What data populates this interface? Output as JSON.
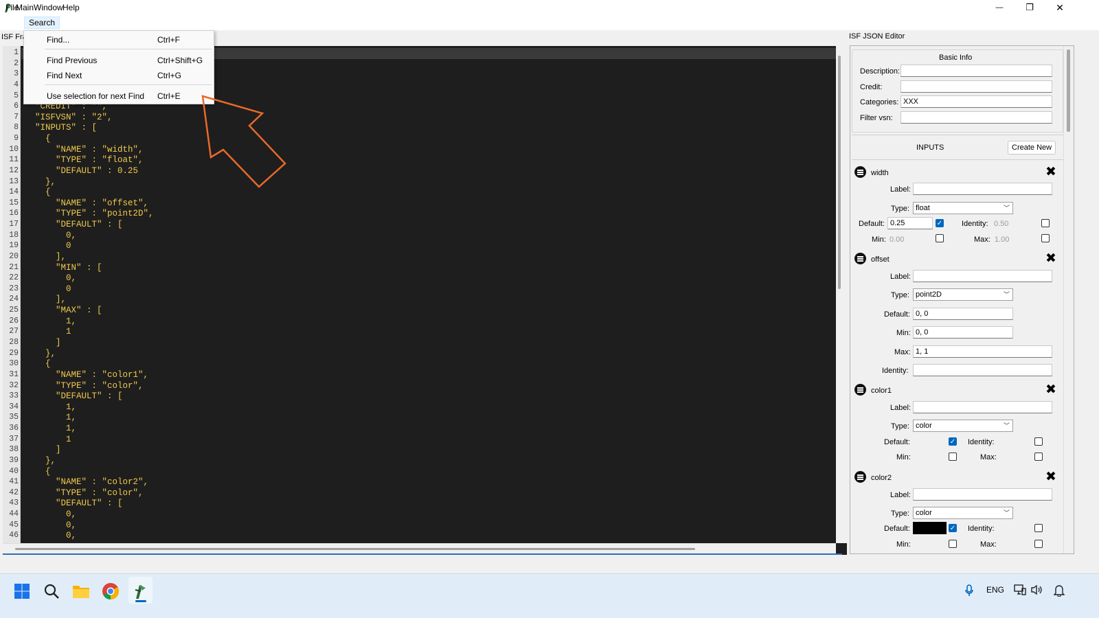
{
  "window": {
    "title": "MainWindow",
    "minimize": "—",
    "maximize": "❐",
    "close": "✕"
  },
  "menubar": {
    "file": "File",
    "search": "Search",
    "help": "Help"
  },
  "left_panel_label": "ISF Fra",
  "search_menu": {
    "items": [
      {
        "label": "Find...",
        "shortcut": "Ctrl+F"
      },
      {
        "label": "Find Previous",
        "shortcut": "Ctrl+Shift+G"
      },
      {
        "label": "Find Next",
        "shortcut": "Ctrl+G"
      },
      {
        "label": "Use selection for next Find",
        "shortcut": "Ctrl+E"
      }
    ]
  },
  "editor": {
    "line_numbers": [
      "1",
      "2",
      "3",
      "4",
      "5",
      "6",
      "7",
      "8",
      "9",
      "10",
      "11",
      "12",
      "13",
      "14",
      "15",
      "16",
      "17",
      "18",
      "19",
      "20",
      "21",
      "22",
      "23",
      "24",
      "25",
      "26",
      "27",
      "28",
      "29",
      "30",
      "31",
      "32",
      "33",
      "34",
      "35",
      "36",
      "37",
      "38",
      "39",
      "40",
      "41",
      "42",
      "43",
      "44",
      "45",
      "46"
    ],
    "lines": [
      "",
      "",
      "",
      "",
      "",
      "  \"CREDIT\" : \"\",",
      "  \"ISFVSN\" : \"2\",",
      "  \"INPUTS\" : [",
      "    {",
      "      \"NAME\" : \"width\",",
      "      \"TYPE\" : \"float\",",
      "      \"DEFAULT\" : 0.25",
      "    },",
      "    {",
      "      \"NAME\" : \"offset\",",
      "      \"TYPE\" : \"point2D\",",
      "      \"DEFAULT\" : [",
      "        0,",
      "        0",
      "      ],",
      "      \"MIN\" : [",
      "        0,",
      "        0",
      "      ],",
      "      \"MAX\" : [",
      "        1,",
      "        1",
      "      ]",
      "    },",
      "    {",
      "      \"NAME\" : \"color1\",",
      "      \"TYPE\" : \"color\",",
      "      \"DEFAULT\" : [",
      "        1,",
      "        1,",
      "        1,",
      "        1",
      "      ]",
      "    },",
      "    {",
      "      \"NAME\" : \"color2\",",
      "      \"TYPE\" : \"color\",",
      "      \"DEFAULT\" : [",
      "        0,",
      "        0,",
      "        0,"
    ]
  },
  "json_editor": {
    "title": "ISF JSON Editor",
    "basic_info": {
      "heading": "Basic Info",
      "description_label": "Description:",
      "description_value": "",
      "credit_label": "Credit:",
      "credit_value": "",
      "categories_label": "Categories:",
      "categories_value": "XXX",
      "filter_vsn_label": "Filter vsn:",
      "filter_vsn_value": ""
    },
    "inputs_heading": "INPUTS",
    "create_new": "Create New",
    "labels": {
      "label": "Label:",
      "type": "Type:",
      "default": "Default:",
      "identity": "Identity:",
      "min": "Min:",
      "max": "Max:"
    },
    "inputs": [
      {
        "name": "width",
        "type": "float",
        "default": "0.25",
        "identity": "0.50",
        "min": "0.00",
        "max": "1.00"
      },
      {
        "name": "offset",
        "type": "point2D",
        "default": "0, 0",
        "min": "0, 0",
        "max": "1, 1",
        "identity": ""
      },
      {
        "name": "color1",
        "type": "color"
      },
      {
        "name": "color2",
        "type": "color"
      }
    ]
  },
  "taskbar": {
    "lang": "ENG"
  },
  "colors": {
    "accent": "#0067c0",
    "arrow": "#e8692a",
    "code": "#f2c94c",
    "editor_bg": "#1e1e1e"
  }
}
